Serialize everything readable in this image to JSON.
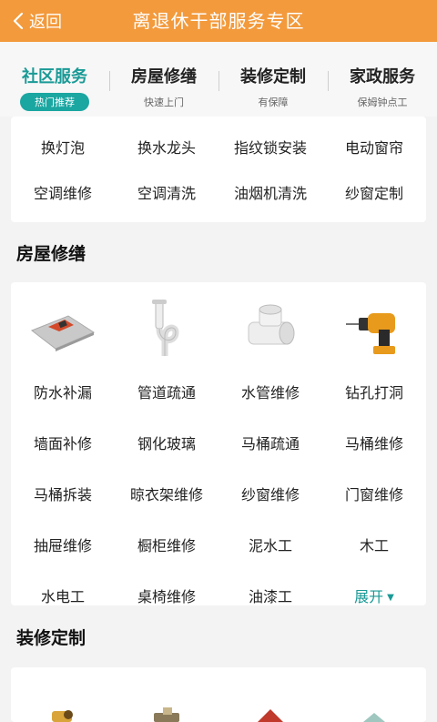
{
  "header": {
    "back_label": "返回",
    "title": "离退休干部服务专区"
  },
  "tabs": [
    {
      "label": "社区服务",
      "sub": "热门推荐"
    },
    {
      "label": "房屋修缮",
      "sub": "快速上门"
    },
    {
      "label": "装修定制",
      "sub": "有保障"
    },
    {
      "label": "家政服务",
      "sub": "保姆钟点工"
    }
  ],
  "community": {
    "items": [
      "换灯泡",
      "换水龙头",
      "指纹锁安装",
      "电动窗帘",
      "空调维修",
      "空调清洗",
      "油烟机清洗",
      "纱窗定制"
    ]
  },
  "repair": {
    "title": "房屋修缮",
    "image_icons": [
      "trowel-icon",
      "drain-pipe-icon",
      "pipe-fitting-icon",
      "power-drill-icon"
    ],
    "items": [
      "防水补漏",
      "管道疏通",
      "水管维修",
      "钻孔打洞",
      "墙面补修",
      "钢化玻璃",
      "马桶疏通",
      "马桶维修",
      "马桶拆装",
      "晾衣架维修",
      "纱窗维修",
      "门窗维修",
      "抽屉维修",
      "橱柜维修",
      "泥水工",
      "木工",
      "水电工",
      "桌椅维修",
      "油漆工"
    ],
    "expand_label": "展开"
  },
  "decor": {
    "title": "装修定制"
  },
  "colors": {
    "header": "#f39a3c",
    "accent": "#1aa6a1",
    "accent_text": "#1a9a96",
    "background": "#f3f3f3"
  }
}
